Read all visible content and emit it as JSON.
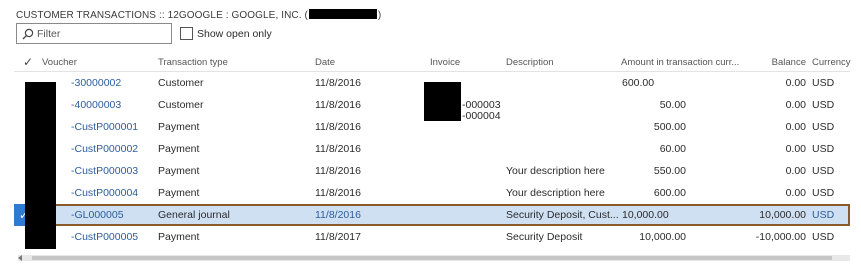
{
  "header": {
    "title_prefix": "CUSTOMER TRANSACTIONS :: 12GOOGLE : GOOGLE, INC. (",
    "title_suffix": ")"
  },
  "filter": {
    "placeholder": "Filter"
  },
  "show_open_only": {
    "label": "Show open only",
    "checked": false
  },
  "columns": {
    "voucher": "Voucher",
    "type": "Transaction type",
    "date": "Date",
    "invoice": "Invoice",
    "description": "Description",
    "amount": "Amount in transaction curr...",
    "balance": "Balance",
    "currency": "Currency"
  },
  "rows": [
    {
      "voucher": "-30000002",
      "type": "Customer",
      "date": "11/8/2016",
      "invoice": "",
      "description": "",
      "amount_left": "600.00",
      "amount_right": "",
      "balance": "0.00",
      "currency": "USD"
    },
    {
      "voucher": "-40000003",
      "type": "Customer",
      "date": "11/8/2016",
      "invoice": "-000003",
      "description": "",
      "amount_left": "",
      "amount_right": "50.00",
      "balance": "0.00",
      "currency": "USD"
    },
    {
      "voucher": "-CustP000001",
      "type": "Payment",
      "date": "11/8/2016",
      "invoice": "-000004",
      "description": "",
      "amount_left": "",
      "amount_right": "500.00",
      "balance": "0.00",
      "currency": "USD"
    },
    {
      "voucher": "-CustP000002",
      "type": "Payment",
      "date": "11/8/2016",
      "invoice": "",
      "description": "",
      "amount_left": "",
      "amount_right": "60.00",
      "balance": "0.00",
      "currency": "USD"
    },
    {
      "voucher": "-CustP000003",
      "type": "Payment",
      "date": "11/8/2016",
      "invoice": "",
      "description": "Your description here",
      "amount_left": "",
      "amount_right": "550.00",
      "balance": "0.00",
      "currency": "USD"
    },
    {
      "voucher": "-CustP000004",
      "type": "Payment",
      "date": "11/8/2016",
      "invoice": "",
      "description": "Your description here",
      "amount_left": "",
      "amount_right": "600.00",
      "balance": "0.00",
      "currency": "USD"
    },
    {
      "voucher": "-GL000005",
      "type": "General journal",
      "date": "11/8/2016",
      "invoice": "",
      "description": "Security Deposit, Cust...",
      "amount_left": "10,000.00",
      "amount_right": "",
      "balance": "10,000.00",
      "currency": "USD",
      "selected": true
    },
    {
      "voucher": "-CustP000005",
      "type": "Payment",
      "date": "11/8/2017",
      "invoice": "",
      "description": "Security Deposit",
      "amount_left": "",
      "amount_right": "10,000.00",
      "balance": "-10,000.00",
      "currency": "USD"
    }
  ],
  "icons": {
    "filter": "search-icon",
    "select_all": "checkmark-icon",
    "row_selected": "checkmark-icon"
  },
  "colors": {
    "link": "#2d5d9d",
    "selected_row": "#cfe0f3",
    "selected_check": "#2f7bd3",
    "selected_outline": "#8a5a2c"
  }
}
